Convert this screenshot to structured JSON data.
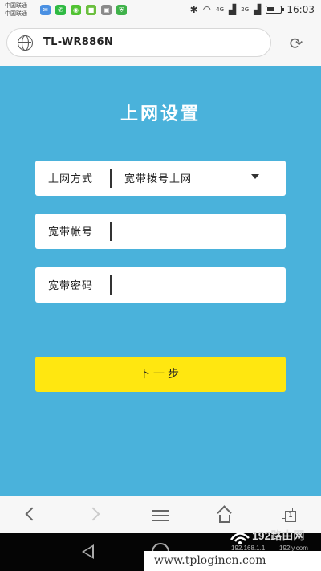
{
  "status_bar": {
    "carrier_1": "中国联通",
    "carrier_2": "中国联通",
    "signal_1": "4G",
    "signal_2": "2G",
    "time": "16:03",
    "app_icons": [
      "notification-app-icon",
      "message-app-icon",
      "wechat-icon",
      "app-icon",
      "image-icon",
      "shield-icon"
    ]
  },
  "browser": {
    "url": "TL-WR886N",
    "reload_icon": "reload-icon"
  },
  "page": {
    "title": "上网设置",
    "connection_type": {
      "label": "上网方式",
      "value": "宽带拨号上网"
    },
    "account": {
      "label": "宽带帐号",
      "value": ""
    },
    "password": {
      "label": "宽带密码",
      "value": ""
    },
    "next_button": "下一步",
    "colors": {
      "background": "#4ab2db",
      "button": "#ffe710",
      "field": "#ffffff"
    }
  },
  "toolbar": {
    "tabs_count": "1",
    "icons": [
      "back-icon",
      "forward-icon",
      "menu-icon",
      "home-icon",
      "tabs-icon"
    ]
  },
  "watermark": {
    "url_text": "www.tplogincn.com",
    "logo_text": "192路由网",
    "logo_sub": "192.168.1.1",
    "logo_sub2": "192ly.com"
  }
}
